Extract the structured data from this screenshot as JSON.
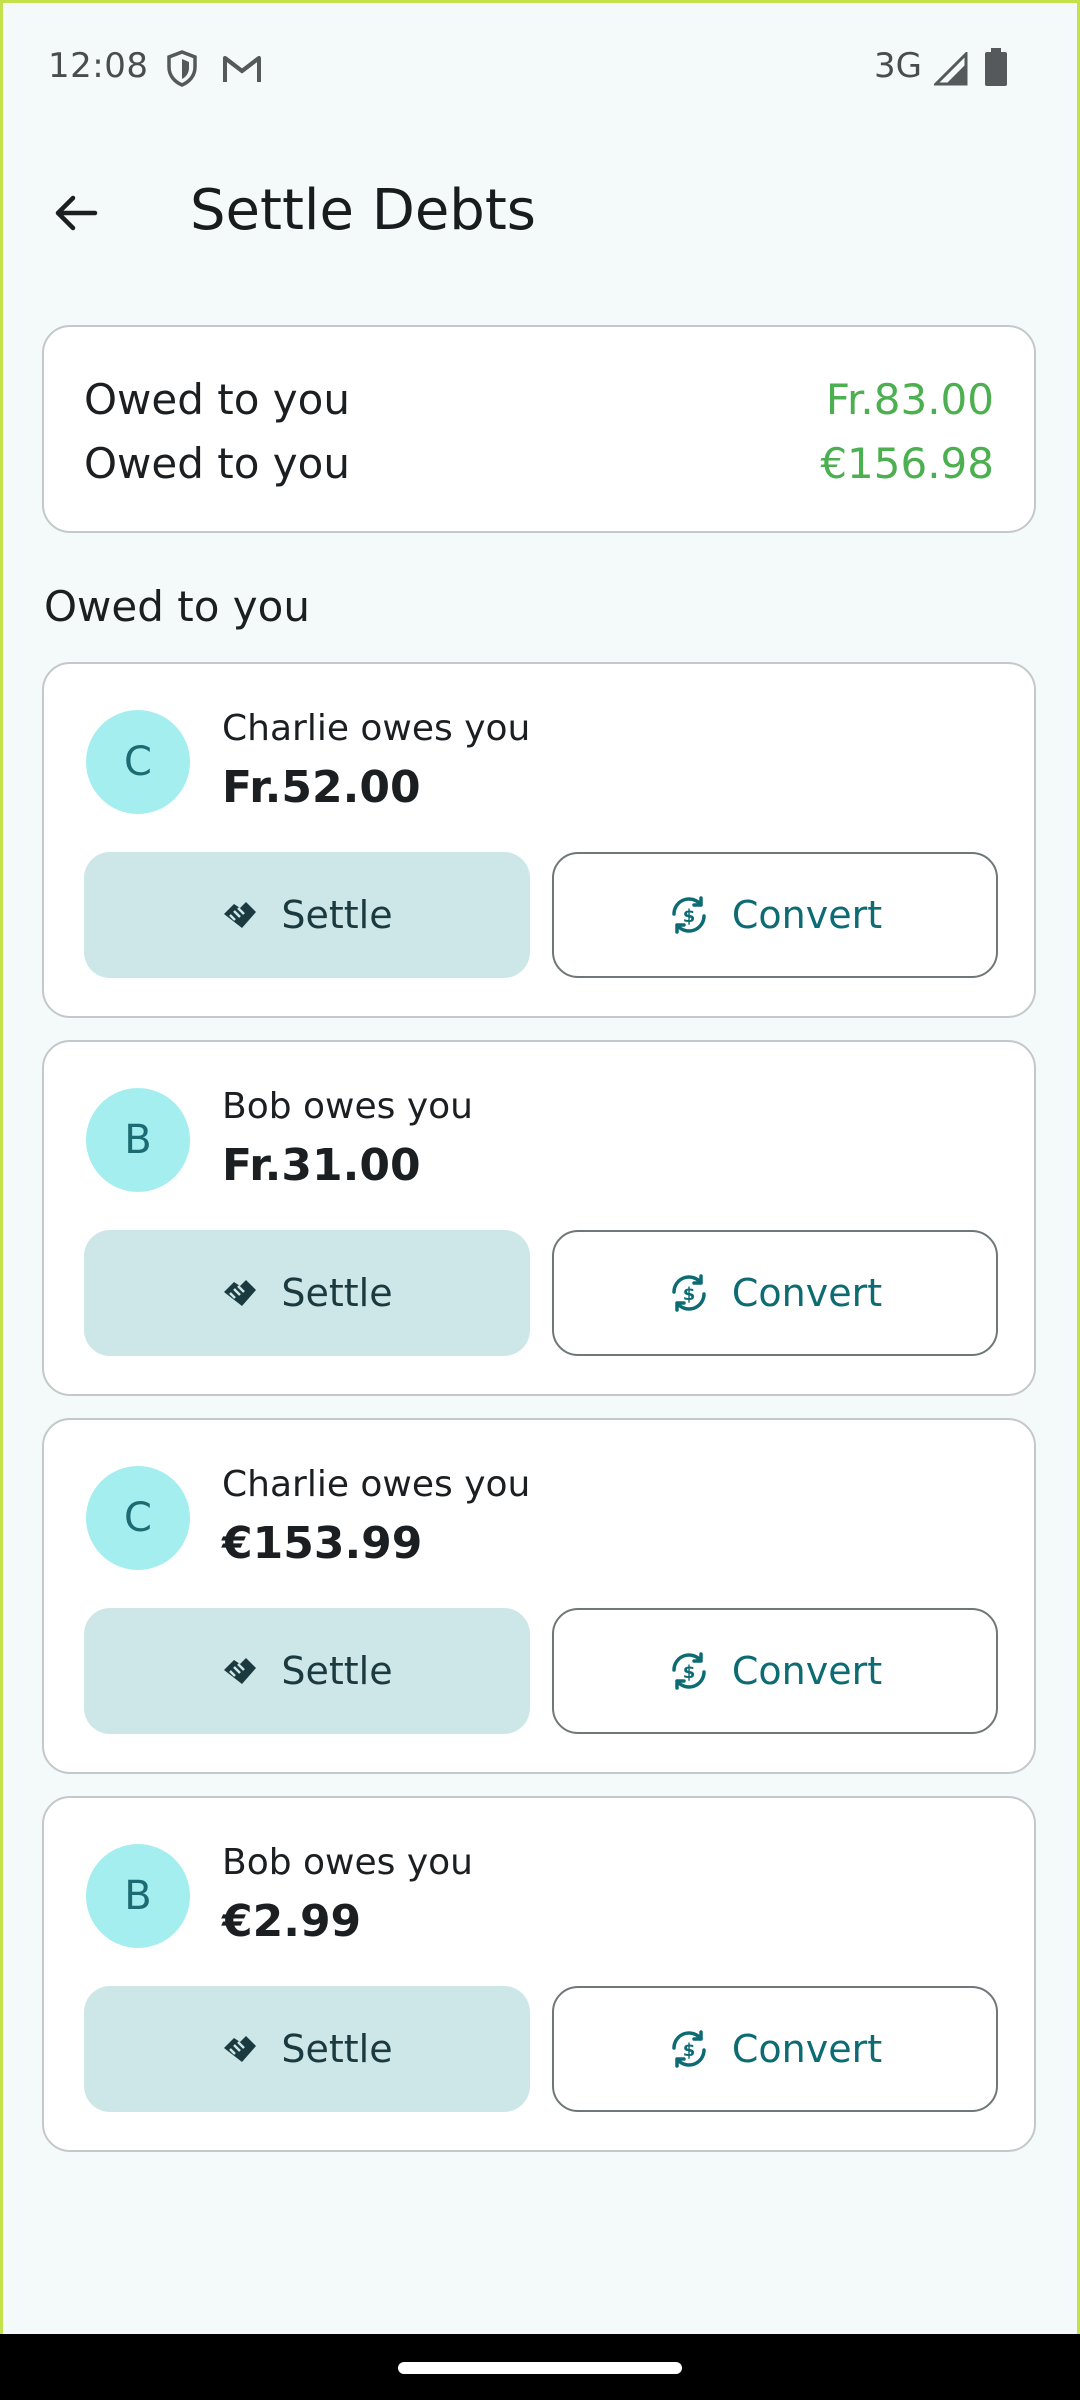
{
  "status_bar": {
    "time": "12:08",
    "network": "3G",
    "icons": [
      "shield-icon",
      "gmail-icon",
      "signal-icon",
      "battery-icon"
    ]
  },
  "app_bar": {
    "title": "Settle Debts",
    "back_icon": "arrow-back-icon"
  },
  "summary": {
    "rows": [
      {
        "label": "Owed to you",
        "amount": "Fr.83.00"
      },
      {
        "label": "Owed to you",
        "amount": "€156.98"
      }
    ]
  },
  "section": {
    "title": "Owed to you"
  },
  "debts": [
    {
      "initial": "C",
      "description": "Charlie owes you",
      "amount": "Fr.52.00",
      "settle_label": "Settle",
      "convert_label": "Convert"
    },
    {
      "initial": "B",
      "description": "Bob owes you",
      "amount": "Fr.31.00",
      "settle_label": "Settle",
      "convert_label": "Convert"
    },
    {
      "initial": "C",
      "description": "Charlie owes you",
      "amount": "€153.99",
      "settle_label": "Settle",
      "convert_label": "Convert"
    },
    {
      "initial": "B",
      "description": "Bob owes you",
      "amount": "€2.99",
      "settle_label": "Settle",
      "convert_label": "Convert"
    }
  ],
  "colors": {
    "accent": "#0d6b73",
    "positive": "#4caf50",
    "avatar_bg": "#a4eef0",
    "settle_bg": "#cde7e9",
    "background": "#f4f9f9"
  }
}
